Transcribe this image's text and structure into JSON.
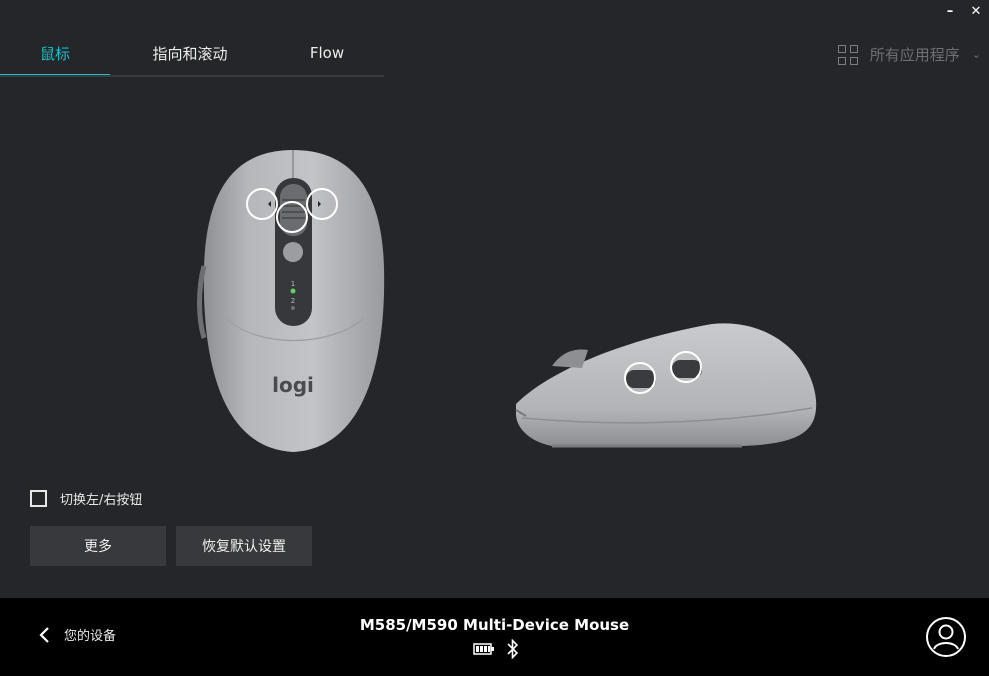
{
  "window": {
    "minimize_label": "–",
    "close_label": "✕"
  },
  "tabs": [
    {
      "label": "鼠标",
      "active": true
    },
    {
      "label": "指向和滚动",
      "active": false
    },
    {
      "label": "Flow",
      "active": false
    }
  ],
  "apps_selector": {
    "label": "所有应用程序",
    "icon": "grid-icon",
    "chevron": "chevron-down-icon"
  },
  "mouse": {
    "logo": "logi",
    "channel_1": "1",
    "channel_2": "2"
  },
  "swap_buttons": {
    "label": "切换左/右按钮",
    "checked": false
  },
  "buttons": {
    "more": "更多",
    "restore": "恢复默认设置"
  },
  "footer": {
    "back_label": "您的设备",
    "device_name": "M585/M590 Multi-Device Mouse",
    "status_icons": [
      "battery-icon",
      "bluetooth-icon"
    ],
    "account_icon": "account-icon"
  },
  "colors": {
    "accent": "#17c1c8",
    "background": "#252629",
    "footer": "#000000"
  }
}
